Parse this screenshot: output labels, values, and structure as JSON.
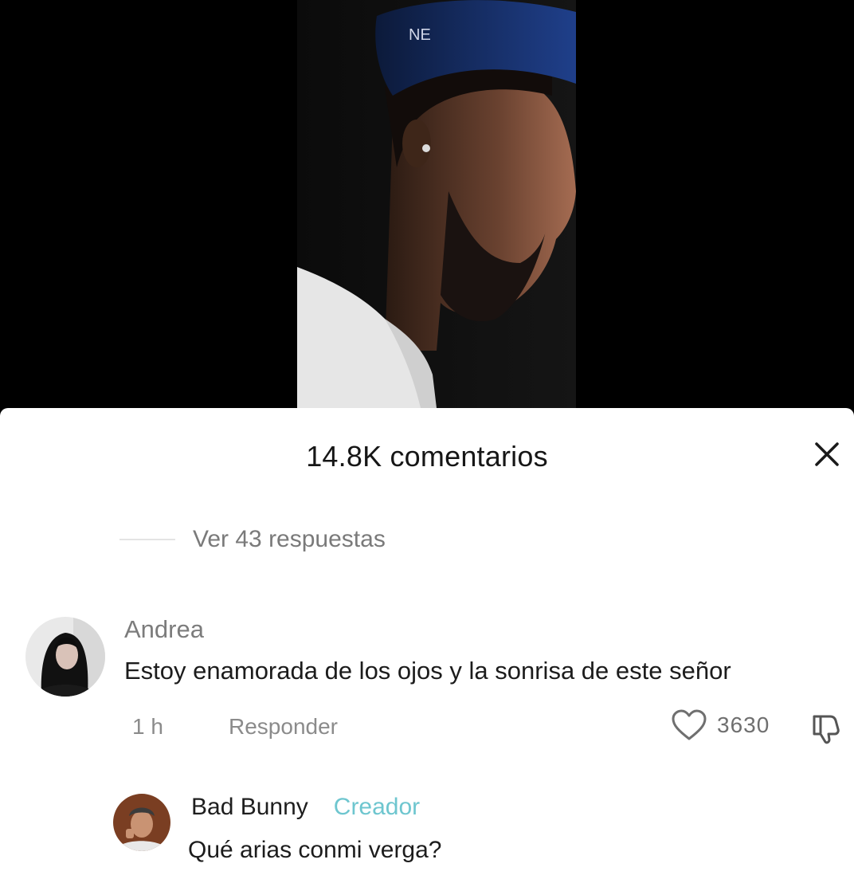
{
  "comments_sheet": {
    "title": "14.8K comentarios",
    "close_icon": "close-icon",
    "view_replies": "Ver 43 respuestas"
  },
  "comment": {
    "username": "Andrea",
    "text": "Estoy enamorada de los ojos y la sonrisa de este señor",
    "time": "1 h",
    "reply_label": "Responder",
    "like_icon": "heart-outline-icon",
    "likes": "3630",
    "dislike_icon": "thumbs-down-icon"
  },
  "reply": {
    "username": "Bad Bunny",
    "badge": "Creador",
    "text": "Qué arias conmi verga?"
  },
  "colors": {
    "badge": "#6ec6cf",
    "muted_text": "#7c7c7c",
    "primary_text": "#161616"
  }
}
